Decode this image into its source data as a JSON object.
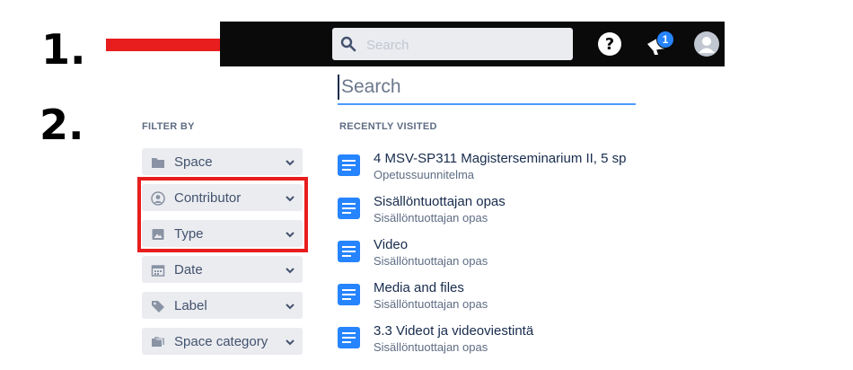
{
  "annotations": {
    "step1": "1.",
    "step2": "2.",
    "arrow_color": "#e81d1d",
    "highlight_color": "#e81d1d"
  },
  "topbar": {
    "search_placeholder": "Search",
    "help_icon": "question-circle-icon",
    "notification_icon": "megaphone-icon",
    "notification_count": "1",
    "avatar_icon": "user-avatar-icon"
  },
  "search": {
    "placeholder": "Search"
  },
  "filters": {
    "heading": "FILTER BY",
    "items": [
      {
        "label": "Space",
        "icon": "folder-icon"
      },
      {
        "label": "Contributor",
        "icon": "person-circle-icon"
      },
      {
        "label": "Type",
        "icon": "image-icon"
      },
      {
        "label": "Date",
        "icon": "calendar-icon"
      },
      {
        "label": "Label",
        "icon": "tag-icon"
      },
      {
        "label": "Space category",
        "icon": "folders-icon"
      }
    ]
  },
  "recent": {
    "heading": "RECENTLY VISITED",
    "items": [
      {
        "title": "4 MSV-SP311 Magisterseminarium II, 5 sp",
        "space": "Opetussuunnitelma"
      },
      {
        "title": "Sisällöntuottajan opas",
        "space": "Sisällöntuottajan opas"
      },
      {
        "title": "Video",
        "space": "Sisällöntuottajan opas"
      },
      {
        "title": "Media and files",
        "space": "Sisällöntuottajan opas"
      },
      {
        "title": "3.3 Videot ja videoviestintä",
        "space": "Sisällöntuottajan opas"
      }
    ]
  }
}
